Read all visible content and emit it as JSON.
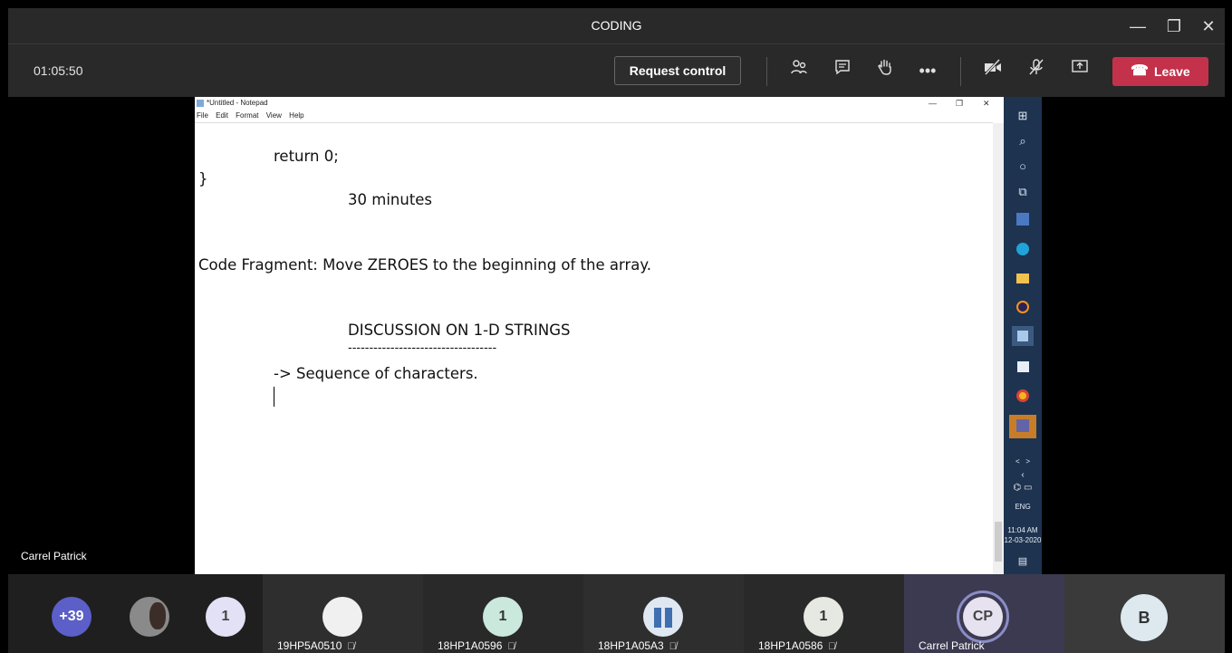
{
  "window": {
    "title": "CODING",
    "minimize": "—",
    "restore": "❐",
    "close": "✕"
  },
  "toolbar": {
    "timer": "01:05:50",
    "request_control": "Request control",
    "leave": "Leave",
    "icons": [
      "participants-icon",
      "chat-icon",
      "raise-hand-icon",
      "more-icon",
      "camera-off-icon",
      "mic-off-icon",
      "share-screen-icon"
    ]
  },
  "presenter": {
    "name": "Carrel Patrick"
  },
  "notepad": {
    "title": "*Untitled - Notepad",
    "menu": [
      "File",
      "Edit",
      "Format",
      "View",
      "Help"
    ],
    "lines": [
      "return 0;",
      "}",
      "30 minutes",
      "Code Fragment: Move ZEROES to the beginning of the array.",
      "DISCUSSION ON 1-D STRINGS",
      "-----------------------------------",
      "-> Sequence of characters."
    ]
  },
  "taskbar": {
    "lang": "ENG",
    "time": "11:04 AM",
    "date": "12-03-2020",
    "badge": "1"
  },
  "participants": {
    "overflow": "+39",
    "tiles": [
      {
        "initial": "1",
        "name": "19HP5A0510"
      },
      {
        "initial": "1",
        "name": "18HP1A0596"
      },
      {
        "initial": "",
        "name": "18HP1A05A3"
      },
      {
        "initial": "1",
        "name": "18HP1A0586"
      },
      {
        "initial": "CP",
        "name": "Carrel Patrick"
      },
      {
        "initial": "B",
        "name": ""
      }
    ],
    "first_group_initial": "1"
  },
  "colors": {
    "leave": "#c4314b",
    "accent": "#6264a7",
    "overflow_avatar": "#5b5fc7"
  }
}
